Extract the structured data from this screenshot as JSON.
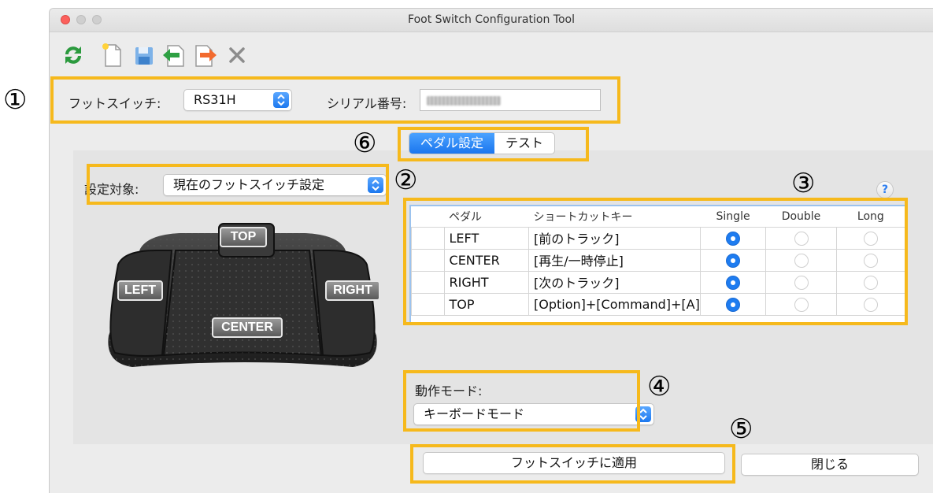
{
  "window": {
    "title": "Foot Switch Configuration Tool"
  },
  "toolbar": {
    "icons": [
      "refresh-icon",
      "new-file-icon",
      "save-icon",
      "import-icon",
      "export-icon",
      "delete-icon"
    ]
  },
  "device": {
    "foot_switch_label": "フットスイッチ:",
    "foot_switch_value": "RS31H",
    "serial_label": "シリアル番号:"
  },
  "tabs": [
    {
      "label": "ペダル設定",
      "selected": true
    },
    {
      "label": "テスト",
      "selected": false
    }
  ],
  "target": {
    "label": "設定対象:",
    "value": "現在のフットスイッチ設定"
  },
  "pedal_image": {
    "top": "TOP",
    "left": "LEFT",
    "right": "RIGHT",
    "center": "CENTER"
  },
  "table": {
    "headers": [
      "ペダル",
      "ショートカットキー",
      "Single",
      "Double",
      "Long"
    ],
    "rows": [
      {
        "pedal": "LEFT",
        "shortcut": "[前のトラック]",
        "mode": "Single"
      },
      {
        "pedal": "CENTER",
        "shortcut": "[再生/一時停止]",
        "mode": "Single"
      },
      {
        "pedal": "RIGHT",
        "shortcut": "[次のトラック]",
        "mode": "Single"
      },
      {
        "pedal": "TOP",
        "shortcut": "[Option]+[Command]+[A]",
        "mode": "Single"
      }
    ],
    "help": "?"
  },
  "mode": {
    "label": "動作モード:",
    "value": "キーボードモード"
  },
  "buttons": {
    "apply": "フットスイッチに適用",
    "close": "閉じる"
  },
  "callouts": [
    "①",
    "②",
    "③",
    "④",
    "⑤",
    "⑥"
  ],
  "colors": {
    "highlight": "#f6b91c",
    "accent": "#1e7cf0",
    "table_border": "#9cc3ee"
  }
}
